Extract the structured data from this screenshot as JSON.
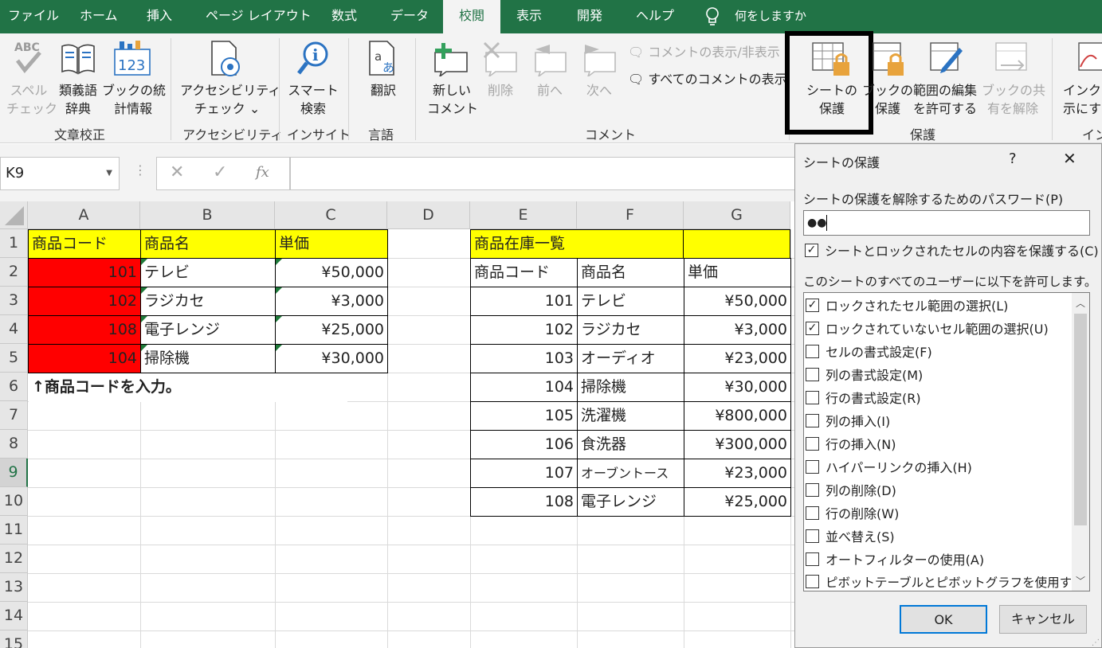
{
  "tabs": [
    "ファイル",
    "ホーム",
    "挿入",
    "ページ レイアウト",
    "数式",
    "データ",
    "校閲",
    "表示",
    "開発",
    "ヘルプ"
  ],
  "tell_me": "何をしますか",
  "ribbon": {
    "spell_1": "スペル",
    "spell_2": "チェック",
    "thes_1": "類義語",
    "thes_2": "辞典",
    "stats_1": "ブックの統",
    "stats_2": "計情報",
    "access_1": "アクセシビリティ",
    "access_2": "チェック ⌄",
    "smart_1": "スマート",
    "smart_2": "検索",
    "translate": "翻訳",
    "new_1": "新しい",
    "new_2": "コメント",
    "delete": "削除",
    "prev": "前へ",
    "next": "次へ",
    "show_comment": "コメントの表示/非表示",
    "show_all": "すべてのコメントの表示",
    "protect_sheet_1": "シートの",
    "protect_sheet_2": "保護",
    "protect_book_1": "ブックの",
    "protect_book_2": "保護",
    "allow_edit_1": "範囲の編集",
    "allow_edit_2": "を許可する",
    "unshare_1": "ブックの共",
    "unshare_2": "有を解除",
    "ink_1": "インクを",
    "ink_2": "示にす",
    "groups": {
      "proof": "文章校正",
      "access": "アクセシビリティ",
      "insight": "インサイト",
      "lang": "言語",
      "comment": "コメント",
      "protect": "保護",
      "ink": "イン"
    }
  },
  "formula_bar": {
    "name_box": "K9",
    "fx": "fx",
    "formula": ""
  },
  "columns": [
    "A",
    "B",
    "C",
    "D",
    "E",
    "F",
    "G"
  ],
  "rows": [
    "1",
    "2",
    "3",
    "4",
    "5",
    "6",
    "7",
    "8",
    "9",
    "10",
    "11",
    "12",
    "13",
    "14",
    "15"
  ],
  "input_table": {
    "headers": [
      "商品コード",
      "商品名",
      "単価"
    ],
    "rows": [
      {
        "code": "101",
        "name": "テレビ",
        "price": "¥50,000"
      },
      {
        "code": "102",
        "name": "ラジカセ",
        "price": "¥3,000"
      },
      {
        "code": "108",
        "name": "電子レンジ",
        "price": "¥25,000"
      },
      {
        "code": "104",
        "name": "掃除機",
        "price": "¥30,000"
      }
    ],
    "note": "↑商品コードを入力。"
  },
  "stock_table": {
    "title": "商品在庫一覧",
    "headers": [
      "商品コード",
      "商品名",
      "単価"
    ],
    "rows": [
      {
        "code": "101",
        "name": "テレビ",
        "price": "¥50,000"
      },
      {
        "code": "102",
        "name": "ラジカセ",
        "price": "¥3,000"
      },
      {
        "code": "103",
        "name": "オーディオ",
        "price": "¥23,000"
      },
      {
        "code": "104",
        "name": "掃除機",
        "price": "¥30,000"
      },
      {
        "code": "105",
        "name": "洗濯機",
        "price": "¥800,000"
      },
      {
        "code": "106",
        "name": "食洗器",
        "price": "¥300,000"
      },
      {
        "code": "107",
        "name": "オーブントース",
        "price": "¥23,000"
      },
      {
        "code": "108",
        "name": "電子レンジ",
        "price": "¥25,000"
      }
    ]
  },
  "dialog": {
    "title": "シートの保護",
    "help": "?",
    "close": "✕",
    "password_label": "シートの保護を解除するためのパスワード(P)",
    "password_value": "●●",
    "protect_contents": "シートとロックされたセルの内容を保護する(C)",
    "allow_label": "このシートのすべてのユーザーに以下を許可します。",
    "options": [
      {
        "label": "ロックされたセル範囲の選択(L)",
        "checked": true
      },
      {
        "label": "ロックされていないセル範囲の選択(U)",
        "checked": true
      },
      {
        "label": "セルの書式設定(F)",
        "checked": false
      },
      {
        "label": "列の書式設定(M)",
        "checked": false
      },
      {
        "label": "行の書式設定(R)",
        "checked": false
      },
      {
        "label": "列の挿入(I)",
        "checked": false
      },
      {
        "label": "行の挿入(N)",
        "checked": false
      },
      {
        "label": "ハイパーリンクの挿入(H)",
        "checked": false
      },
      {
        "label": "列の削除(D)",
        "checked": false
      },
      {
        "label": "行の削除(W)",
        "checked": false
      },
      {
        "label": "並べ替え(S)",
        "checked": false
      },
      {
        "label": "オートフィルターの使用(A)",
        "checked": false
      },
      {
        "label": "ピボットテーブルとピボットグラフを使用する",
        "checked": false
      }
    ],
    "ok": "OK",
    "cancel": "キャンセル"
  }
}
